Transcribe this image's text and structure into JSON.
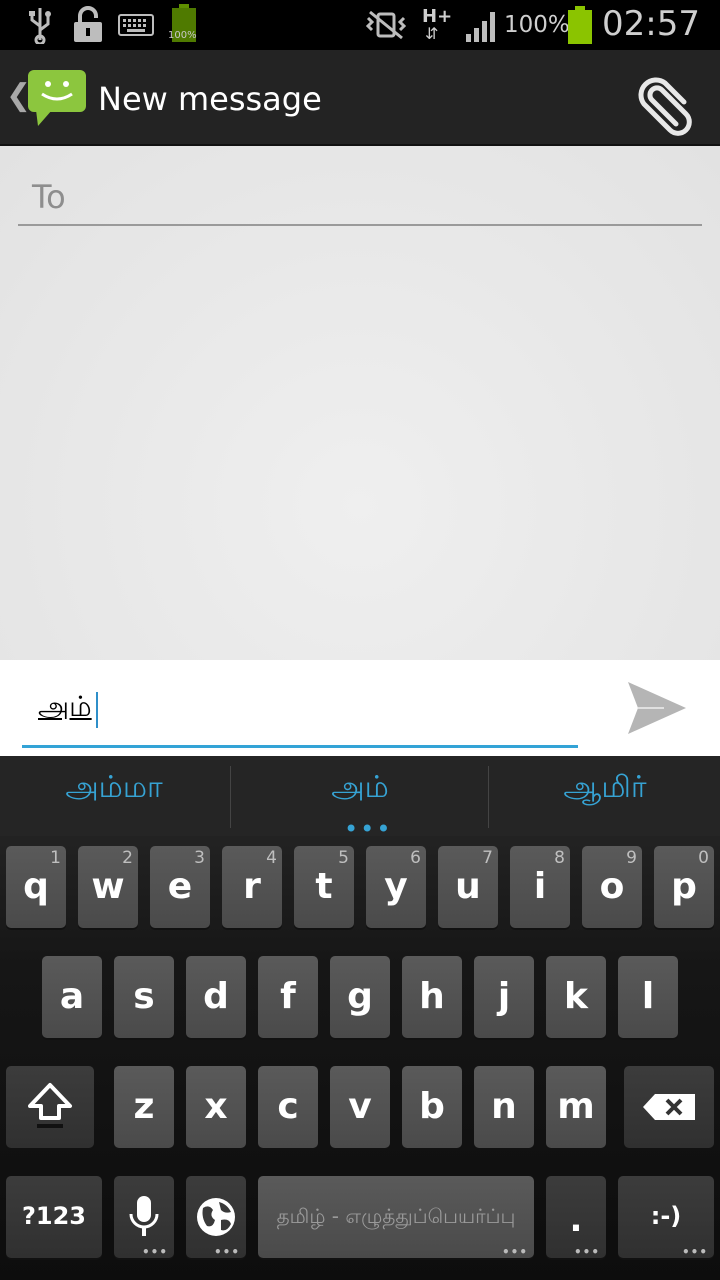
{
  "status_bar": {
    "battery_small_label": "100%",
    "network_type": "H+",
    "battery_percent": "100%",
    "time": "02:57"
  },
  "action_bar": {
    "title": "New message",
    "back_glyph": "❮"
  },
  "compose": {
    "to_placeholder": "To"
  },
  "message": {
    "text": "அம்"
  },
  "suggestions": [
    "அம்மா",
    "அம்",
    "ஆமிர்"
  ],
  "keyboard": {
    "row1": [
      {
        "label": "q",
        "hint": "1"
      },
      {
        "label": "w",
        "hint": "2"
      },
      {
        "label": "e",
        "hint": "3"
      },
      {
        "label": "r",
        "hint": "4"
      },
      {
        "label": "t",
        "hint": "5"
      },
      {
        "label": "y",
        "hint": "6"
      },
      {
        "label": "u",
        "hint": "7"
      },
      {
        "label": "i",
        "hint": "8"
      },
      {
        "label": "o",
        "hint": "9"
      },
      {
        "label": "p",
        "hint": "0"
      }
    ],
    "row2": [
      "a",
      "s",
      "d",
      "f",
      "g",
      "h",
      "j",
      "k",
      "l"
    ],
    "row3": [
      "z",
      "x",
      "c",
      "v",
      "b",
      "n",
      "m"
    ],
    "symbols_label": "?123",
    "space_label": "தமிழ் - எழுத்துப்பெயர்ப்பு",
    "period_label": ".",
    "smiley_label": ":-)"
  },
  "icons": {
    "status": [
      "usb-icon",
      "unlocked-icon",
      "keyboard-icon",
      "battery-icon",
      "signal-bars-icon",
      "vibrate-off-icon"
    ],
    "action": [
      "messaging-app-icon",
      "attach-paperclip-icon"
    ],
    "keyboard": [
      "shift-icon",
      "delete-icon",
      "microphone-icon",
      "globe-icon"
    ],
    "send": "send-icon"
  },
  "colors": {
    "accent": "#33a3d6",
    "battery_green": "#8bc400",
    "app_icon_green": "#8cc63e"
  }
}
